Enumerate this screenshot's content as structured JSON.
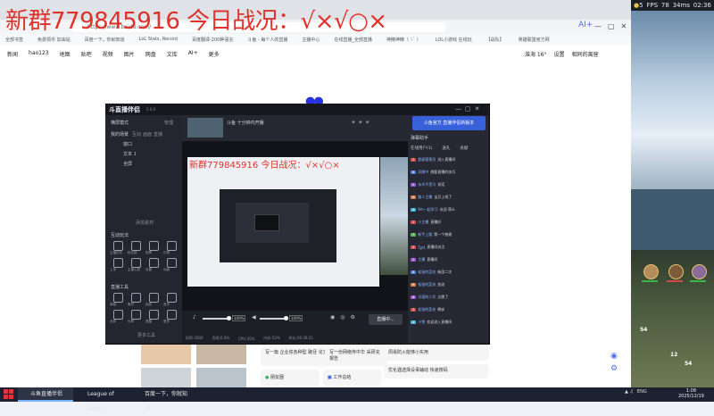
{
  "overlay": {
    "title": "新群779845916 今日战况：√×√○×"
  },
  "browser": {
    "url": "https://www.baidu.com/",
    "ai_label": "AI+",
    "bookmarks": [
      "全部书签",
      "免费领币 加油站",
      "百度一下，你就知道",
      "LoL Stats, Record",
      "百度翻译-200种语言",
      "斗鱼 - 每个人的直播",
      "主播中心",
      "在线直播_全部直播",
      "神精神精（ '-` ）",
      "LOL小游戏 在线玩",
      "【战队】",
      "英雄联盟官方网"
    ],
    "nav_links": [
      "新闻",
      "hao123",
      "地图",
      "贴吧",
      "视频",
      "图片",
      "网盘",
      "文库",
      "AI+",
      "更多"
    ],
    "weather": "淮海  16°",
    "settings": "设置",
    "username": "相同的离座",
    "cards": [
      "写一篇 企业债各种型 路径 论文",
      "写一份网络传中华 采研充报告",
      "周易防火能够小实用",
      "优化遇选择设事辅动 快速搜码"
    ],
    "friends_label": "朋友圈",
    "work_label": "工作总结"
  },
  "game": {
    "gold": "5",
    "fps": "FPS",
    "fps_value": "78",
    "ping": "34ms",
    "time": "02:36",
    "map_numbers": [
      "54",
      "12",
      "54"
    ]
  },
  "app": {
    "logo": "斗直播伴侣",
    "version": "5.0.0",
    "scene_mode": "横屏模式",
    "manage": "管理",
    "sources_header": "我的场景",
    "sources_tabs": [
      "互动",
      "画面",
      "直播"
    ],
    "sources": [
      "窗口",
      "文本 1",
      "全屏"
    ],
    "add_source": "添加素材",
    "section_interact": "互动玩法",
    "section_tools": "直播工具",
    "more_tools": "更多工具",
    "interact_items": [
      "主播任务",
      "粉丝团",
      "投票",
      "礼物",
      "上传",
      "主播心愿",
      "设置",
      "动画"
    ],
    "tool_items": [
      "弹幕",
      "素材",
      "抽奖",
      "音乐",
      "全屏",
      "分屏",
      "提醒",
      "更多"
    ],
    "stream_title": "斗鱼 十分钟内开播",
    "pct_left": "100%",
    "pct_right": "100%",
    "live_button": "直播中...",
    "status": [
      "码率:3580",
      "丢帧:0.0%",
      "CPU:35%",
      "内存:52%",
      "时长:00:38:21"
    ],
    "right_banner": "斗鱼官方 直播伴侣新版本",
    "right_title": "弹幕助手",
    "right_tabs": [
      "在线用户(1)",
      "送礼",
      "贡献"
    ],
    "chat": [
      {
        "badge": "3",
        "color": "#d44f4f",
        "name": "超级管理员",
        "text": "进入直播间"
      },
      {
        "badge": "6",
        "color": "#4f7fd4",
        "name": "风眼中",
        "text": "想要直播的技巧"
      },
      {
        "badge": "2",
        "color": "#9b59d0",
        "name": "永木不是马",
        "text": "说话"
      },
      {
        "badge": "5",
        "color": "#d4804f",
        "name": "路人主播",
        "text": "宝贝上线了"
      },
      {
        "badge": "4",
        "color": "#4fb0d4",
        "name": "8m一起学习",
        "text": "欢迎 萌么"
      },
      {
        "badge": "1",
        "color": "#d44f4f",
        "name": "小主播",
        "text": "直播好"
      },
      {
        "badge": "7",
        "color": "#5ab35a",
        "name": "新手上路",
        "text": "第一个感谢"
      },
      {
        "badge": "3",
        "color": "#d44f4f",
        "name": "Tptt",
        "text": "直播间关注"
      },
      {
        "badge": "2",
        "color": "#9b59d0",
        "name": "主播",
        "text": "直播间"
      },
      {
        "badge": "8",
        "color": "#4f7fd4",
        "name": "松鼠的蓝衣",
        "text": "新团二次"
      },
      {
        "badge": "5",
        "color": "#d4804f",
        "name": "松鼠的蓝衣",
        "text": "加油"
      },
      {
        "badge": "6",
        "color": "#9b59d0",
        "name": "贝塔的二号",
        "text": "太晚了"
      },
      {
        "badge": "3",
        "color": "#d44f4f",
        "name": "松鼠的蓝衣",
        "text": "晚安"
      },
      {
        "badge": "4",
        "color": "#4fb0d4",
        "name": "小雪",
        "text": "欢迎进入直播间"
      }
    ]
  },
  "taskbar": {
    "items": [
      "斗鱼直播伴侣",
      "League of Legen...",
      "百度一下，你就知道"
    ],
    "tray_lang": "ENG",
    "clock_time": "1:08",
    "clock_date": "2025/12/19"
  }
}
